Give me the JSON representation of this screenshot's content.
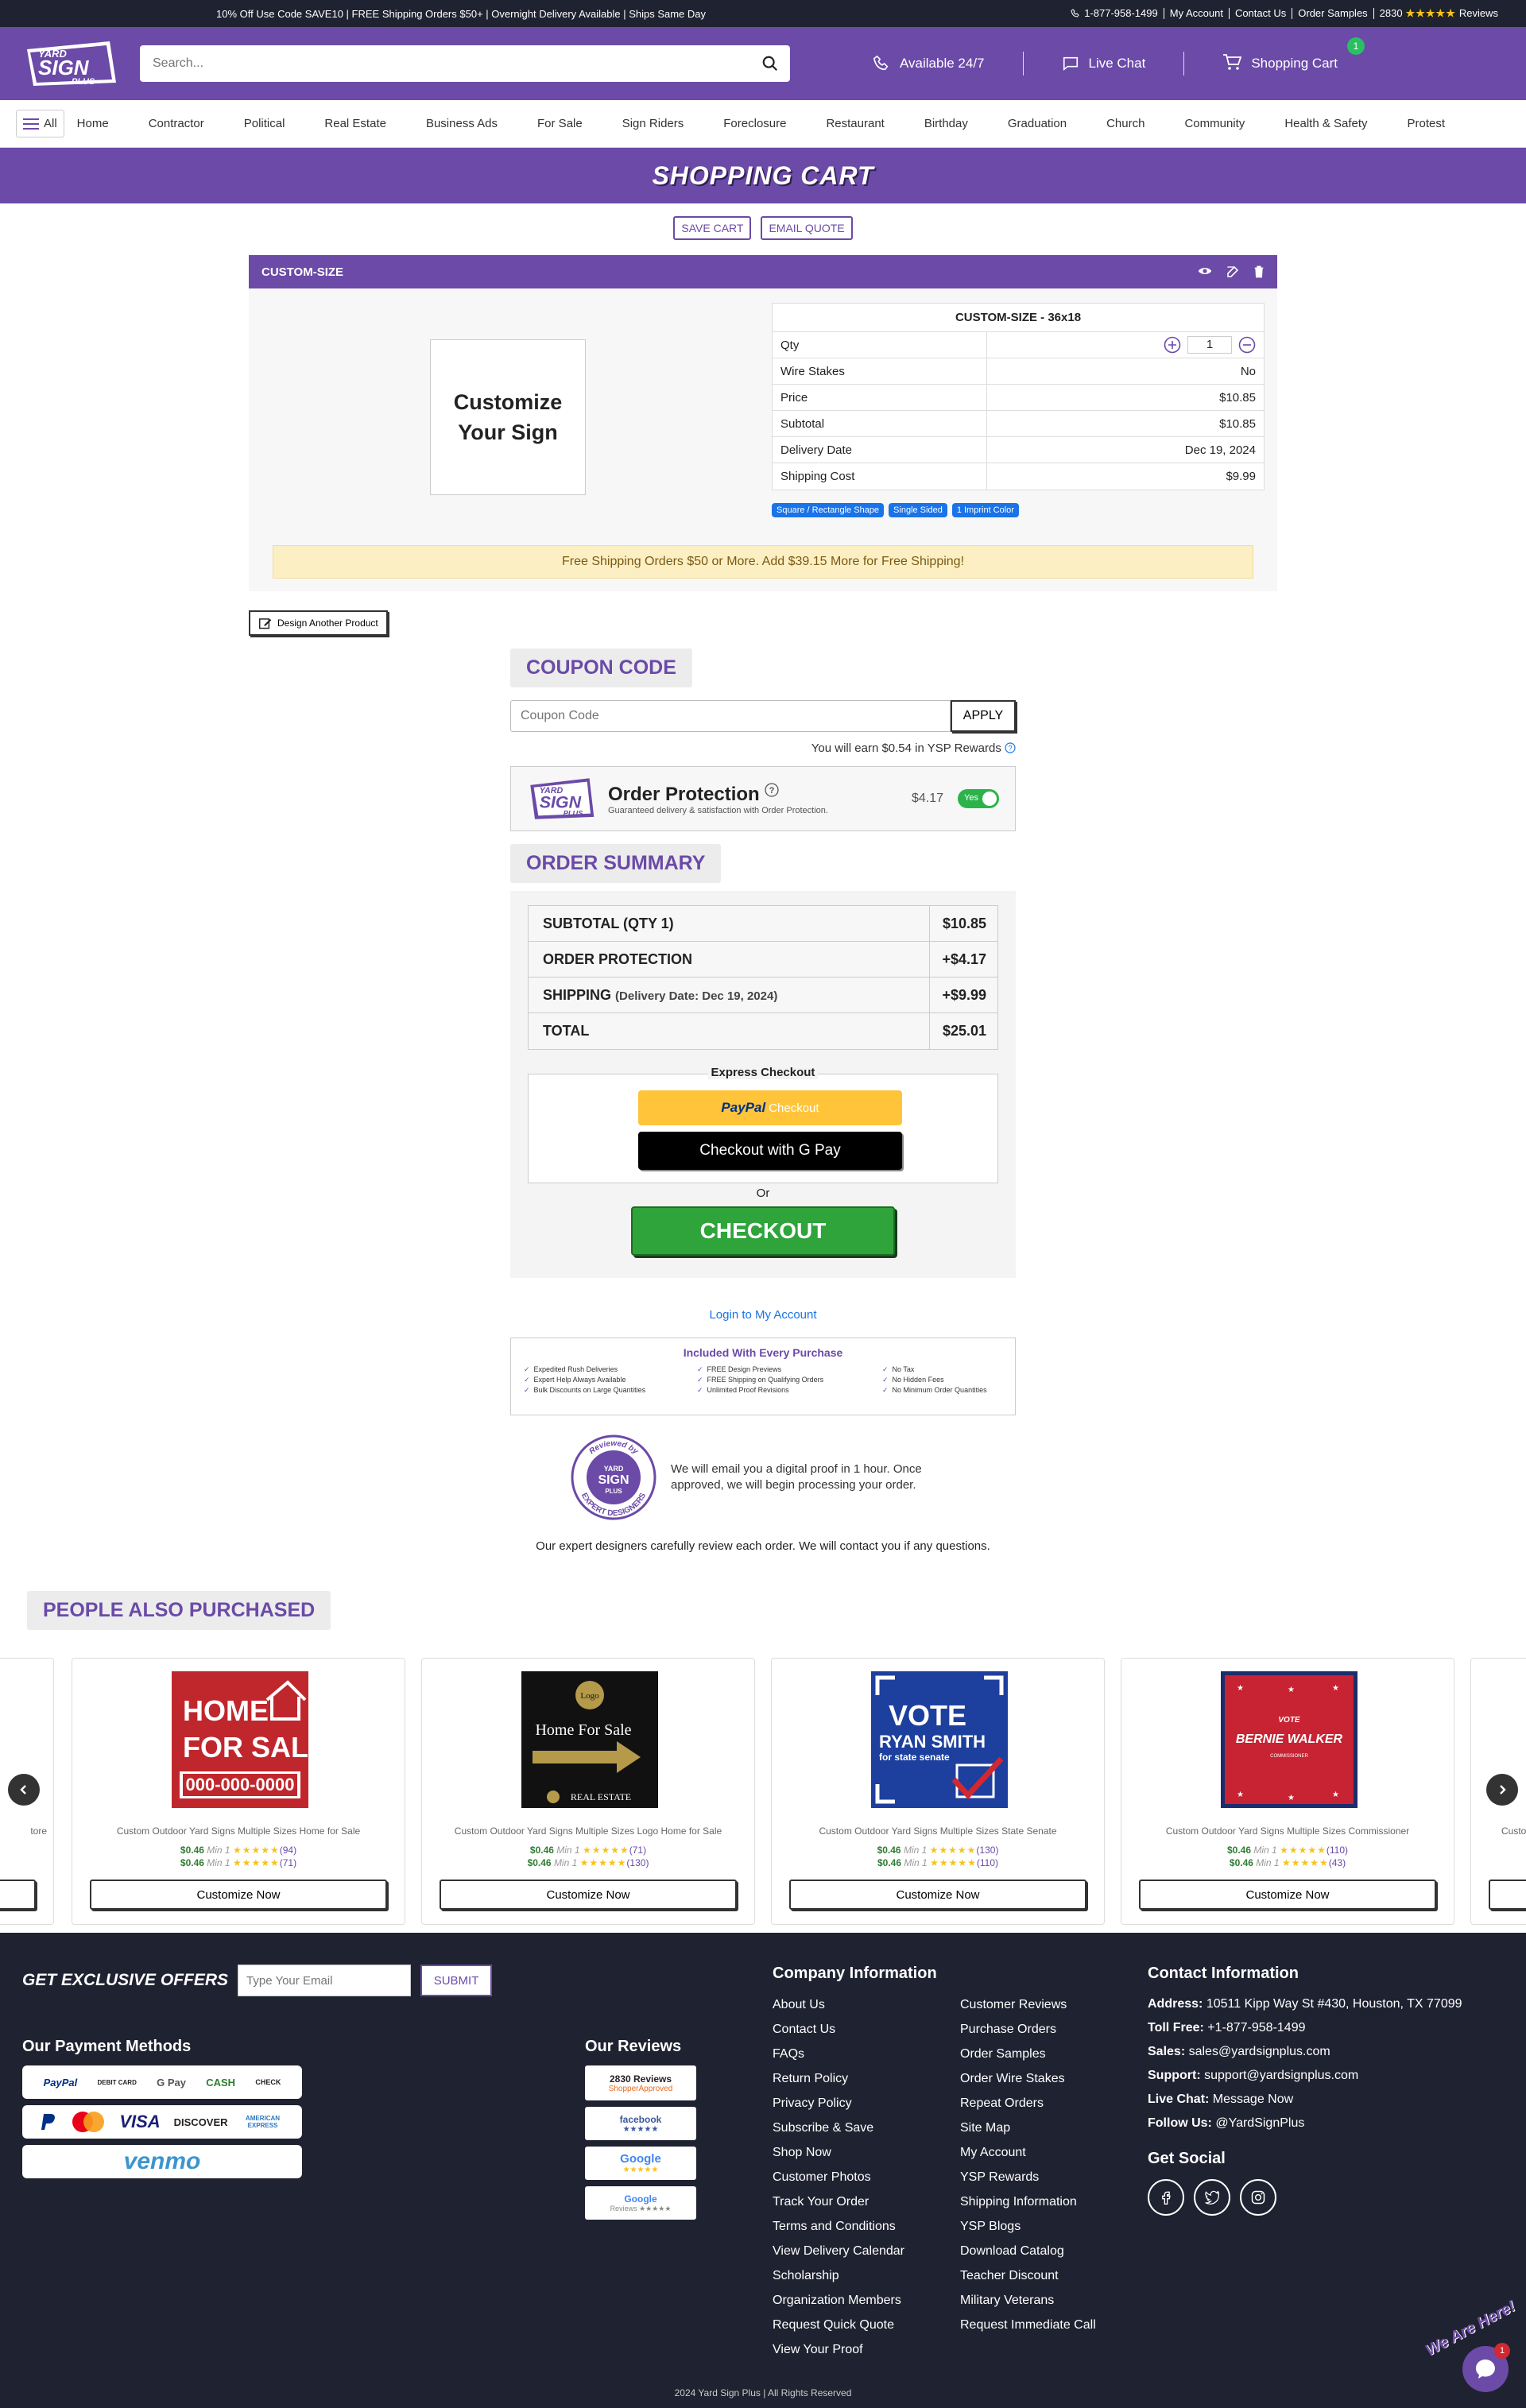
{
  "topbar": {
    "promo": "10% Off Use Code SAVE10 | FREE Shipping Orders $50+ | Overnight Delivery Available | Ships Same Day",
    "phone": "1-877-958-1499",
    "links": [
      "My Account",
      "Contact Us",
      "Order Samples"
    ],
    "review_count": "2830",
    "stars": "★★★★★",
    "reviews_label": "Reviews"
  },
  "header": {
    "logo_text": [
      "YARD",
      "SIGN",
      "PLUS"
    ],
    "search_placeholder": "Search...",
    "available": "Available 24/7",
    "live_chat": "Live Chat",
    "cart": "Shopping Cart",
    "cart_count": "1"
  },
  "nav": {
    "all_label": "All",
    "items": [
      "Home",
      "Contractor",
      "Political",
      "Real Estate",
      "Business Ads",
      "For Sale",
      "Sign Riders",
      "Foreclosure",
      "Restaurant",
      "Birthday",
      "Graduation",
      "Church",
      "Community",
      "Health & Safety",
      "Protest"
    ]
  },
  "page_title": "SHOPPING CART",
  "cart_actions": {
    "save": "SAVE CART",
    "email": "EMAIL QUOTE"
  },
  "cart_item": {
    "header": "CUSTOM-SIZE",
    "thumb_text": "Customize Your Sign",
    "title": "CUSTOM-SIZE - 36x18",
    "qty_label": "Qty",
    "qty_value": "1",
    "rows": [
      {
        "k": "Wire Stakes",
        "v": "No"
      },
      {
        "k": "Price",
        "v": "$10.85"
      },
      {
        "k": "Subtotal",
        "v": "$10.85"
      },
      {
        "k": "Delivery Date",
        "v": "Dec 19, 2024"
      },
      {
        "k": "Shipping Cost",
        "v": "$9.99"
      }
    ],
    "tags": [
      "Square / Rectangle Shape",
      "Single Sided",
      "1 Imprint Color"
    ],
    "free_shipping": "Free Shipping Orders $50 or More. Add $39.15 More for Free Shipping!"
  },
  "design_another": "Design Another Product",
  "coupon": {
    "heading": "COUPON CODE",
    "placeholder": "Coupon Code",
    "apply": "APPLY",
    "rewards": "You will earn $0.54 in YSP Rewards"
  },
  "protection": {
    "title": "Order Protection",
    "subtitle": "Guaranteed delivery & satisfaction with Order Protection.",
    "price": "$4.17",
    "toggle": "Yes"
  },
  "summary": {
    "heading": "ORDER SUMMARY",
    "rows": [
      {
        "k": "SUBTOTAL (QTY 1)",
        "sub": "",
        "v": "$10.85"
      },
      {
        "k": "ORDER PROTECTION",
        "sub": "",
        "v": "+$4.17"
      },
      {
        "k": "SHIPPING",
        "sub": "(Delivery Date: Dec 19, 2024)",
        "v": "+$9.99"
      },
      {
        "k": "TOTAL",
        "sub": "",
        "v": "$25.01"
      }
    ],
    "express": "Express Checkout",
    "paypal_brand": "PayPal",
    "paypal_suffix": "Checkout",
    "gpay": "Checkout with G Pay",
    "or": "Or",
    "checkout": "CHECKOUT"
  },
  "login": "Login to My Account",
  "included": {
    "title": "Included With Every Purchase",
    "items": [
      "Expedited Rush Deliveries",
      "FREE Design Previews",
      "No Tax",
      "Expert Help Always Available",
      "FREE Shipping on Qualifying Orders",
      "No Hidden Fees",
      "Bulk Discounts on Large Quantities",
      "Unlimited Proof Revisions",
      "No Minimum Order Quantities"
    ]
  },
  "expert": {
    "badge_top": "Reviewed by",
    "badge_bottom": "EXPERT DESIGNERS",
    "text": "We will email you a digital proof in 1 hour. Once approved, we will begin processing your order.",
    "note": "Our expert designers carefully review each order. We will contact you if any questions."
  },
  "people_heading": "PEOPLE ALSO PURCHASED",
  "products": [
    {
      "name": "Custom Outdoor Yard Signs Multiple Sizes Home for Sale",
      "l1": {
        "p": "$0.46",
        "m": "Min 1",
        "c": "(94)"
      },
      "l2": {
        "p": "$0.46",
        "m": "Min 1",
        "c": "(71)"
      },
      "btn": "Customize Now",
      "sign_a": "HOME",
      "sign_b": "FOR SALE",
      "sign_c": "000-000-0000"
    },
    {
      "name": "Custom Outdoor Yard Signs Multiple Sizes Logo Home for Sale",
      "l1": {
        "p": "$0.46",
        "m": "Min 1",
        "c": "(71)"
      },
      "l2": {
        "p": "$0.46",
        "m": "Min 1",
        "c": "(130)"
      },
      "btn": "Customize Now",
      "sign_a": "Logo",
      "sign_b": "Home For Sale",
      "sign_c": "REAL ESTATE"
    },
    {
      "name": "Custom Outdoor Yard Signs Multiple Sizes State Senate",
      "l1": {
        "p": "$0.46",
        "m": "Min 1",
        "c": "(130)"
      },
      "l2": {
        "p": "$0.46",
        "m": "Min 1",
        "c": "(110)"
      },
      "btn": "Customize Now",
      "sign_a": "VOTE",
      "sign_b": "RYAN SMITH",
      "sign_c": "for state senate"
    },
    {
      "name": "Custom Outdoor Yard Signs Multiple Sizes Commissioner",
      "l1": {
        "p": "$0.46",
        "m": "Min 1",
        "c": "(110)"
      },
      "l2": {
        "p": "$0.46",
        "m": "Min 1",
        "c": "(43)"
      },
      "btn": "Customize Now",
      "sign_a": "VOTE",
      "sign_b": "BERNIE WALKER",
      "sign_c": "COMMISSIONER"
    }
  ],
  "partial_left_name": "tore",
  "partial_right_name": "Custo",
  "footer": {
    "offers": "GET EXCLUSIVE OFFERS",
    "email_placeholder": "Type Your Email",
    "submit": "SUBMIT",
    "payment_heading": "Our Payment Methods",
    "pay_row1": [
      "PayPal",
      "DEBIT CARD",
      "G Pay",
      "CASH",
      "CHECK"
    ],
    "pay_row2": [
      "VISA",
      "DISCOVER",
      "AMERICAN EXPRESS"
    ],
    "venmo": "venmo",
    "reviews_heading": "Our Reviews",
    "review_badges": [
      {
        "a": "2830 Reviews",
        "b": "ShopperApproved"
      },
      {
        "a": "facebook",
        "b": "★★★★★"
      },
      {
        "a": "Google",
        "b": "★★★★★"
      },
      {
        "a": "Google",
        "b": "Reviews ★★★★★"
      }
    ],
    "company_heading": "Company Information",
    "col1": [
      "About Us",
      "Contact Us",
      "FAQs",
      "Return Policy",
      "Privacy Policy",
      "Subscribe & Save",
      "Shop Now",
      "Customer Photos",
      "Track Your Order",
      "Terms and Conditions",
      "View Delivery Calendar",
      "Scholarship",
      "Organization Members",
      "Request Quick Quote",
      "View Your Proof"
    ],
    "col2": [
      "Customer Reviews",
      "Purchase Orders",
      "Order Samples",
      "Order Wire Stakes",
      "Repeat Orders",
      "Site Map",
      "My Account",
      "YSP Rewards",
      "Shipping Information",
      "YSP Blogs",
      "Download Catalog",
      "Teacher Discount",
      "Military Veterans",
      "Request Immediate Call"
    ],
    "contact_heading": "Contact Information",
    "contact": [
      {
        "k": "Address:",
        "v": "10511 Kipp Way St #430, Houston, TX 77099"
      },
      {
        "k": "Toll Free:",
        "v": "+1-877-958-1499"
      },
      {
        "k": "Sales:",
        "v": "sales@yardsignplus.com"
      },
      {
        "k": "Support:",
        "v": "support@yardsignplus.com"
      },
      {
        "k": "Live Chat:",
        "v": "Message Now"
      },
      {
        "k": "Follow Us:",
        "v": "@YardSignPlus"
      }
    ],
    "social_heading": "Get Social",
    "copyright": "2024 Yard Sign Plus | All Rights Reserved",
    "we_are_here": "We Are Here!",
    "chat_badge": "1"
  },
  "colors": {
    "brand": "#6b4aa8",
    "dark": "#1f2230",
    "checkout": "#2ea43a",
    "tag": "#1a73e8"
  }
}
